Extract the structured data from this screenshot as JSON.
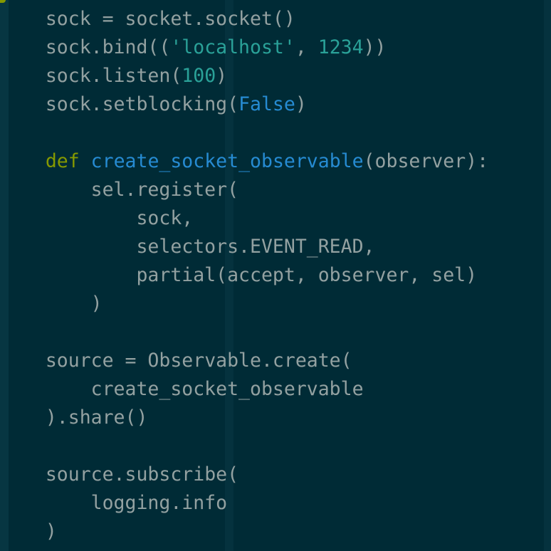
{
  "editor": {
    "theme": {
      "background": "#002b36",
      "guide": "#073642",
      "text": "#93a1a1",
      "keyword": "#859900",
      "function": "#268bd2",
      "string": "#2aa198",
      "number": "#2aa198",
      "constant": "#268bd2"
    },
    "lines": [
      {
        "indent": "  ",
        "tokens": [
          {
            "t": "sock = socket.socket()",
            "k": "plain"
          }
        ]
      },
      {
        "indent": "  ",
        "tokens": [
          {
            "t": "sock.bind((",
            "k": "plain"
          },
          {
            "t": "'localhost'",
            "k": "str"
          },
          {
            "t": ", ",
            "k": "plain"
          },
          {
            "t": "1234",
            "k": "num"
          },
          {
            "t": "))",
            "k": "plain"
          }
        ]
      },
      {
        "indent": "  ",
        "tokens": [
          {
            "t": "sock.listen(",
            "k": "plain"
          },
          {
            "t": "100",
            "k": "num"
          },
          {
            "t": ")",
            "k": "plain"
          }
        ]
      },
      {
        "indent": "  ",
        "tokens": [
          {
            "t": "sock.setblocking(",
            "k": "plain"
          },
          {
            "t": "False",
            "k": "const"
          },
          {
            "t": ")",
            "k": "plain"
          }
        ]
      },
      {
        "indent": "",
        "tokens": []
      },
      {
        "indent": "  ",
        "tokens": [
          {
            "t": "def",
            "k": "kw"
          },
          {
            "t": " ",
            "k": "plain"
          },
          {
            "t": "create_socket_observable",
            "k": "fn"
          },
          {
            "t": "(observer):",
            "k": "plain"
          }
        ]
      },
      {
        "indent": "    ",
        "tokens": [
          {
            "t": "sel.register(",
            "k": "plain"
          }
        ]
      },
      {
        "indent": "      ",
        "tokens": [
          {
            "t": "sock,",
            "k": "plain"
          }
        ]
      },
      {
        "indent": "      ",
        "tokens": [
          {
            "t": "selectors.EVENT_READ,",
            "k": "plain"
          }
        ]
      },
      {
        "indent": "      ",
        "tokens": [
          {
            "t": "partial(accept, observer, sel)",
            "k": "plain"
          }
        ]
      },
      {
        "indent": "    ",
        "tokens": [
          {
            "t": ")",
            "k": "plain"
          }
        ]
      },
      {
        "indent": "",
        "tokens": []
      },
      {
        "indent": "  ",
        "tokens": [
          {
            "t": "source = Observable.create(",
            "k": "plain"
          }
        ]
      },
      {
        "indent": "    ",
        "tokens": [
          {
            "t": "create_socket_observable",
            "k": "plain"
          }
        ]
      },
      {
        "indent": "  ",
        "tokens": [
          {
            "t": ").share()",
            "k": "plain"
          }
        ]
      },
      {
        "indent": "",
        "tokens": []
      },
      {
        "indent": "  ",
        "tokens": [
          {
            "t": "source.subscribe(",
            "k": "plain"
          }
        ]
      },
      {
        "indent": "    ",
        "tokens": [
          {
            "t": "logging.info",
            "k": "plain"
          }
        ]
      },
      {
        "indent": "  ",
        "tokens": [
          {
            "t": ")",
            "k": "plain"
          }
        ]
      }
    ]
  }
}
